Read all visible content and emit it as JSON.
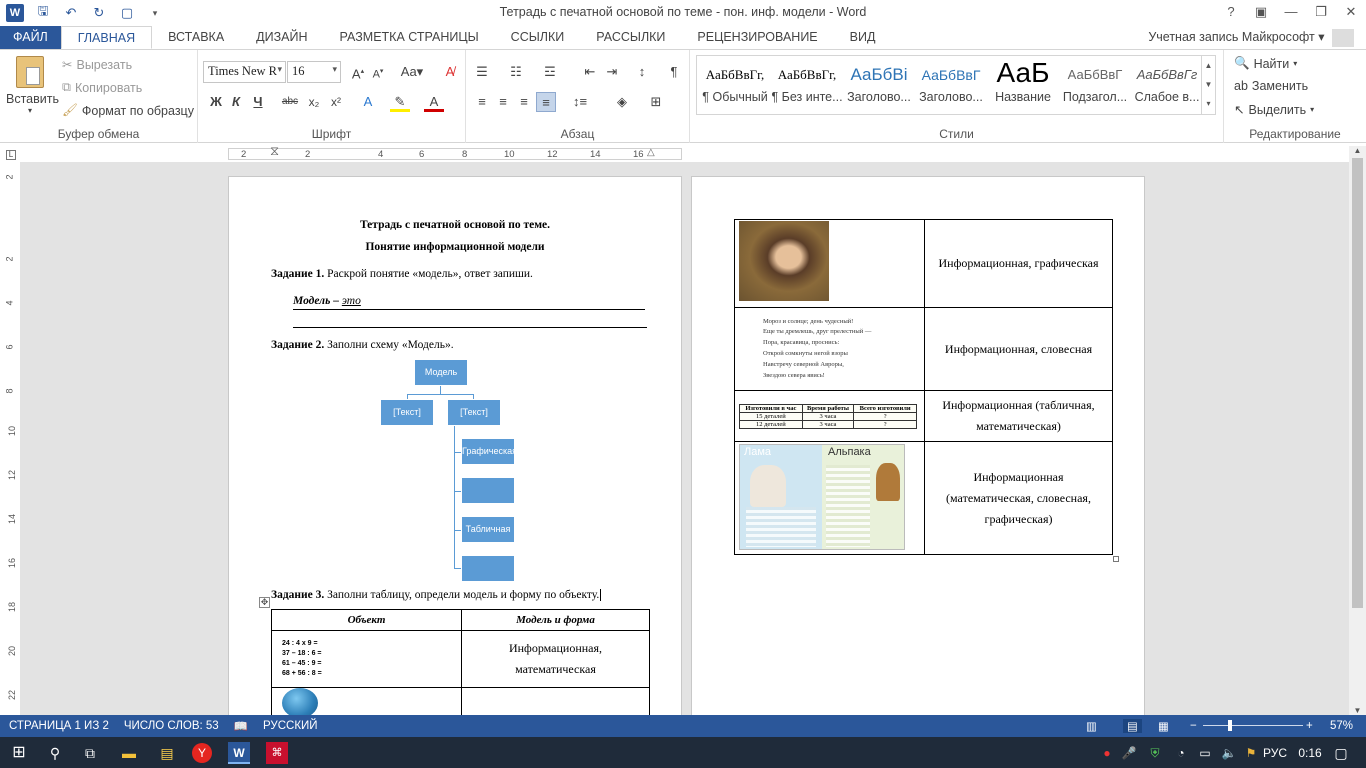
{
  "window": {
    "title": "Тетрадь с печатной основой по теме - пон. инф. модели - Word"
  },
  "tabs": [
    "ФАЙЛ",
    "ГЛАВНАЯ",
    "ВСТАВКА",
    "ДИЗАЙН",
    "РАЗМЕТКА СТРАНИЦЫ",
    "ССЫЛКИ",
    "РАССЫЛКИ",
    "РЕЦЕНЗИРОВАНИЕ",
    "ВИД"
  ],
  "account": "Учетная запись Майкрософт",
  "clipboard": {
    "paste": "Вставить",
    "cut": "Вырезать",
    "copy": "Копировать",
    "format_painter": "Формат по образцу",
    "label": "Буфер обмена"
  },
  "font": {
    "name": "Times New R",
    "size": "16",
    "label": "Шрифт",
    "bold": "Ж",
    "italic": "К",
    "underline": "Ч",
    "strike": "abc"
  },
  "paragraph": {
    "label": "Абзац"
  },
  "styles": {
    "label": "Стили",
    "items": [
      {
        "preview": "АаБбВвГг,",
        "name": "¶ Обычный"
      },
      {
        "preview": "АаБбВвГг,",
        "name": "¶ Без инте..."
      },
      {
        "preview": "АаБбВі",
        "name": "Заголово..."
      },
      {
        "preview": "АаБбВвГ",
        "name": "Заголово..."
      },
      {
        "preview": "АаБ",
        "name": "Название"
      },
      {
        "preview": "АаБбВвГ",
        "name": "Подзагол..."
      },
      {
        "preview": "АаБбВвГг",
        "name": "Слабое в..."
      }
    ]
  },
  "editing": {
    "find": "Найти",
    "replace": "Заменить",
    "select": "Выделить",
    "label": "Редактирование"
  },
  "ruler": {
    "h_ticks": [
      "2",
      "2",
      "4",
      "6",
      "8",
      "10",
      "12",
      "14",
      "16"
    ],
    "v_ticks": [
      "2",
      "2",
      "4",
      "6",
      "8",
      "10",
      "12",
      "14",
      "16",
      "18",
      "20",
      "22"
    ]
  },
  "doc": {
    "title1": "Тетрадь с печатной основой по теме.",
    "title2": "Понятие информационной модели",
    "task1_label": "Задание 1.",
    "task1_text": " Раскрой понятие «модель», ответ запиши.",
    "model_line": "Модель – ",
    "model_eto": "это",
    "task2_label": "Задание 2.",
    "task2_text": " Заполни схему «Модель».",
    "diagram": {
      "root": "Модель",
      "left": "[Текст]",
      "right": "[Текст]",
      "sub1": "Графическая",
      "sub2": "",
      "sub3": "Табличная",
      "sub4": ""
    },
    "task3_label": "Задание 3.",
    "task3_text": " Заполни таблицу, определи модель и форму по объекту.",
    "table_head": {
      "object": "Объект",
      "model": "Модель и форма"
    },
    "row1_math": [
      "24 : 4 х 9 =",
      "37 – 18 : 6 =",
      "61 – 45 : 9 =",
      "68 + 56 : 8 ="
    ],
    "row1_model": "Информационная, математическая",
    "row2_model": "И"
  },
  "page2": {
    "rows": [
      {
        "model": "Информационная, графическая"
      },
      {
        "poem": [
          "Мороз и солнце; день чудесный!",
          "Еще ты дремлешь, друг прелестный —",
          "Пора, красавица, проснись:",
          "Открой сомкнуты негой взоры",
          "Навстречу северной Авроры,",
          "Звездою севера явись!"
        ],
        "model": "Информационная, словесная"
      },
      {
        "mini_table": {
          "headers": [
            "Изготовили в час",
            "Время работы",
            "Всего изготовили"
          ],
          "rows": [
            [
              "15 деталей",
              "3 часа",
              "?"
            ],
            [
              "12 деталей",
              "3 часа",
              "?"
            ]
          ]
        },
        "model": "Информационная (табличная, математическая)"
      },
      {
        "llama": "Лама",
        "alpaca": "Альпака",
        "model": "Информационная (математическая, словесная, графическая)"
      }
    ]
  },
  "status": {
    "page": "СТРАНИЦА 1 ИЗ 2",
    "words": "ЧИСЛО СЛОВ: 53",
    "lang": "РУССКИЙ",
    "zoom": "57%"
  },
  "taskbar": {
    "lang": "РУС",
    "time": "0:16"
  }
}
